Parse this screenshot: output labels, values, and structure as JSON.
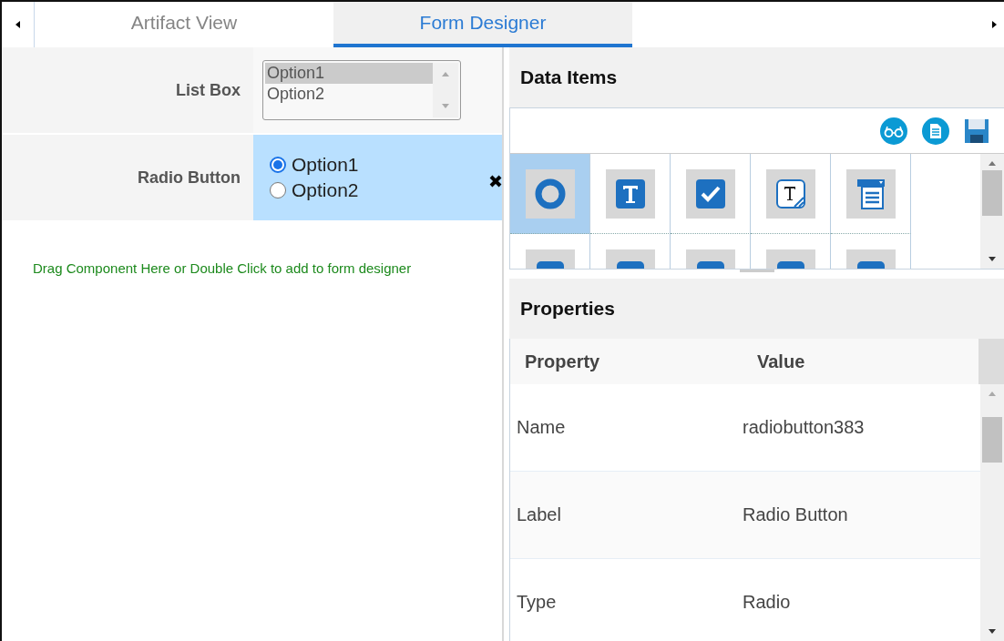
{
  "tabs": [
    {
      "label": "Artifact View",
      "selected": false
    },
    {
      "label": "Form Designer",
      "selected": true
    }
  ],
  "form_designer": {
    "fields": [
      {
        "kind": "listbox",
        "label": "List Box",
        "selected": false,
        "options": [
          {
            "label": "Option1",
            "selected": true
          },
          {
            "label": "Option2",
            "selected": false
          }
        ]
      },
      {
        "kind": "radio",
        "label": "Radio Button",
        "selected": true,
        "options": [
          {
            "label": "Option1",
            "selected": true
          },
          {
            "label": "Option2",
            "selected": false
          }
        ]
      }
    ],
    "drop_hint": "Drag Component Here or Double Click to add to form designer"
  },
  "data_items": {
    "title": "Data Items",
    "palette": [
      {
        "kind": "radio",
        "selected": true
      },
      {
        "kind": "text",
        "selected": false
      },
      {
        "kind": "checkbox",
        "selected": false
      },
      {
        "kind": "textarea",
        "selected": false
      },
      {
        "kind": "dropdown",
        "selected": false
      },
      {
        "kind": "partial",
        "selected": false
      },
      {
        "kind": "partial",
        "selected": false
      },
      {
        "kind": "partial",
        "selected": false
      },
      {
        "kind": "partial",
        "selected": false
      },
      {
        "kind": "partial",
        "selected": false
      }
    ]
  },
  "properties": {
    "title": "Properties",
    "columns": [
      "Property",
      "Value"
    ],
    "rows": [
      [
        "Name",
        "radiobutton383"
      ],
      [
        "Label",
        "Radio Button"
      ],
      [
        "Type",
        "Radio"
      ]
    ]
  }
}
